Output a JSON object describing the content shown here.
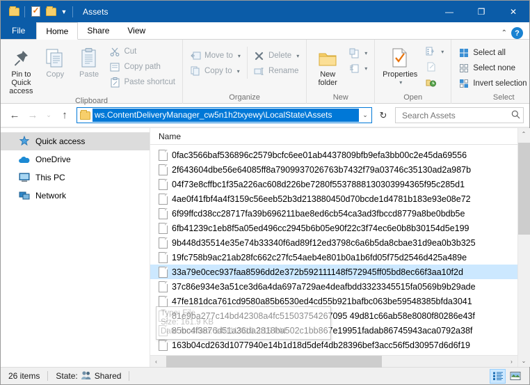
{
  "window": {
    "title": "Assets",
    "quick_access_icons": [
      "folder-icon",
      "properties-icon",
      "new-folder-icon"
    ],
    "quick_access_caret": "▼",
    "minimize": "—",
    "maximize": "❐",
    "close": "✕",
    "accent_color": "#0b5ca8",
    "selection_color": "#cce8ff"
  },
  "tabs": {
    "file": "File",
    "items": [
      {
        "label": "Home",
        "active": true
      },
      {
        "label": "Share",
        "active": false
      },
      {
        "label": "View",
        "active": false
      }
    ],
    "collapse_caret": "⌃",
    "help_label": "?"
  },
  "ribbon": {
    "groups": [
      {
        "label": "Clipboard",
        "big_buttons": [
          {
            "label": "Pin to Quick access",
            "icon": "pin-icon",
            "dim": false
          },
          {
            "label": "Copy",
            "icon": "copy-icon",
            "dim": true
          },
          {
            "label": "Paste",
            "icon": "paste-icon",
            "dim": true
          }
        ],
        "small_buttons": [
          {
            "label": "Cut",
            "icon": "scissors-icon",
            "dim": true
          },
          {
            "label": "Copy path",
            "icon": "copy-path-icon",
            "dim": true
          },
          {
            "label": "Paste shortcut",
            "icon": "paste-shortcut-icon",
            "dim": true
          }
        ]
      },
      {
        "label": "Organize",
        "small_buttons": [
          {
            "label": "Move to",
            "icon": "move-to-icon",
            "dim": true,
            "caret": "▾"
          },
          {
            "label": "Copy to",
            "icon": "copy-to-icon",
            "dim": true,
            "caret": "▾"
          }
        ],
        "small_buttons2": [
          {
            "label": "Delete",
            "icon": "delete-icon",
            "dim": true,
            "caret": "▾"
          },
          {
            "label": "Rename",
            "icon": "rename-icon",
            "dim": true,
            "caret": ""
          }
        ]
      },
      {
        "label": "New",
        "big_buttons": [
          {
            "label": "New folder",
            "icon": "new-folder-icon",
            "dim": false
          }
        ],
        "small_buttons": [
          {
            "label": "",
            "icon": "new-item-icon",
            "dim": true,
            "caret": "▾"
          },
          {
            "label": "",
            "icon": "easy-access-icon",
            "dim": true,
            "caret": "▾"
          }
        ]
      },
      {
        "label": "Open",
        "big_buttons": [
          {
            "label": "Properties",
            "icon": "properties-icon",
            "dim": false,
            "caret": "▾"
          }
        ],
        "small_buttons": [
          {
            "label": "",
            "icon": "open-icon",
            "dim": true,
            "caret": "▾"
          },
          {
            "label": "",
            "icon": "edit-icon",
            "dim": true,
            "caret": ""
          },
          {
            "label": "",
            "icon": "history-icon",
            "dim": false,
            "caret": ""
          }
        ]
      },
      {
        "label": "Select",
        "small_buttons": [
          {
            "label": "Select all",
            "icon": "select-all-icon",
            "dim": false
          },
          {
            "label": "Select none",
            "icon": "select-none-icon",
            "dim": false
          },
          {
            "label": "Invert selection",
            "icon": "invert-selection-icon",
            "dim": false
          }
        ]
      }
    ]
  },
  "navbar": {
    "back": "←",
    "forward": "→",
    "recent": "⌄",
    "up": "↑",
    "address_value": "ws.ContentDeliveryManager_cw5n1h2txyewy\\LocalState\\Assets",
    "address_caret": "⌄",
    "refresh": "↻",
    "search_placeholder": "Search Assets",
    "search_value": "",
    "search_icon": "search-icon"
  },
  "sidebar": {
    "items": [
      {
        "label": "Quick access",
        "icon": "star-pin-icon",
        "selected": true
      },
      {
        "label": "OneDrive",
        "icon": "onedrive-cloud-icon",
        "selected": false
      },
      {
        "label": "This PC",
        "icon": "this-pc-monitor-icon",
        "selected": false
      },
      {
        "label": "Network",
        "icon": "network-icon",
        "selected": false
      }
    ]
  },
  "filepane": {
    "column_header": "Name",
    "sort_indicator": "⌃",
    "rows": [
      {
        "name": "0fac3566baf536896c2579bcfc6ee01ab4437809bfb9efa3bb00c2e45da69556",
        "selected": false
      },
      {
        "name": "2f643604dbe56e64085ff8a7909937026763b7432f79a03746c35130ad2a987b",
        "selected": false
      },
      {
        "name": "04f73e8cffbc1f35a226ac608d226be7280f5537888130303994365f95c285d1",
        "selected": false
      },
      {
        "name": "4ae0f41fbf4a4f3159c56eeb52b3d213880450d70bcde1d4781b183e93e08e72",
        "selected": false
      },
      {
        "name": "6f99ffcd38cc28717fa39b696211bae8ed6cb54ca3ad3fbccd8779a8be0bdb5e",
        "selected": false
      },
      {
        "name": "6fb41239c1eb8f5a05ed496cc2945b6b05e90f22c3f74ec6e0b8b30154d5e199",
        "selected": false
      },
      {
        "name": "9b448d35514e35e74b33340f6ad89f12ed3798c6a6b5da8cbae31d9ea0b3b325",
        "selected": false
      },
      {
        "name": "19fc758b9ac21ab28fc662c27fc54aeb4e801b0a1b6fd05f75d2546d425a489e",
        "selected": false
      },
      {
        "name": "33a79e0cec937faa8596dd2e372b592111148f572945ff05bd8ec66f3aa10f2d",
        "selected": true
      },
      {
        "name": "37c86e934e3a51ce3d6a4da697a729ae4deafbdd3323345515fa0569b9b29ade",
        "selected": false
      },
      {
        "name": "47fe181dca761cd9580a85b6530ed4cd55b921bafbc063be59548385bfda3041",
        "selected": false
      },
      {
        "name": "81e9ba277c14bd42308a4fc51503754267095 49d81c66ab58e8080f80286e43f",
        "selected": false
      },
      {
        "name": "85bc4f3876d51a36da2818ba502c1bb867e19951fadab86745943aca0792a38f",
        "selected": false
      },
      {
        "name": "163b04cd263d1077940e14b1d18d5def4db28396bef3acc56f5d30957d6d6f19",
        "selected": false
      }
    ],
    "tooltip": {
      "line1": "Type: File",
      "line2": "Size: 161.9 KB",
      "line3": "Date modified: 14/11/2016 3:15 PM"
    }
  },
  "scrollbars": {
    "v_up": "⌃",
    "v_down": "⌄",
    "h_left": "‹",
    "h_right": "›"
  },
  "statusbar": {
    "item_count": "26 items",
    "state_label": "State:",
    "state_value": "Shared",
    "state_icon": "shared-people-icon",
    "view_details_icon": "details-view-icon",
    "view_large_icon": "large-icons-view-icon"
  }
}
